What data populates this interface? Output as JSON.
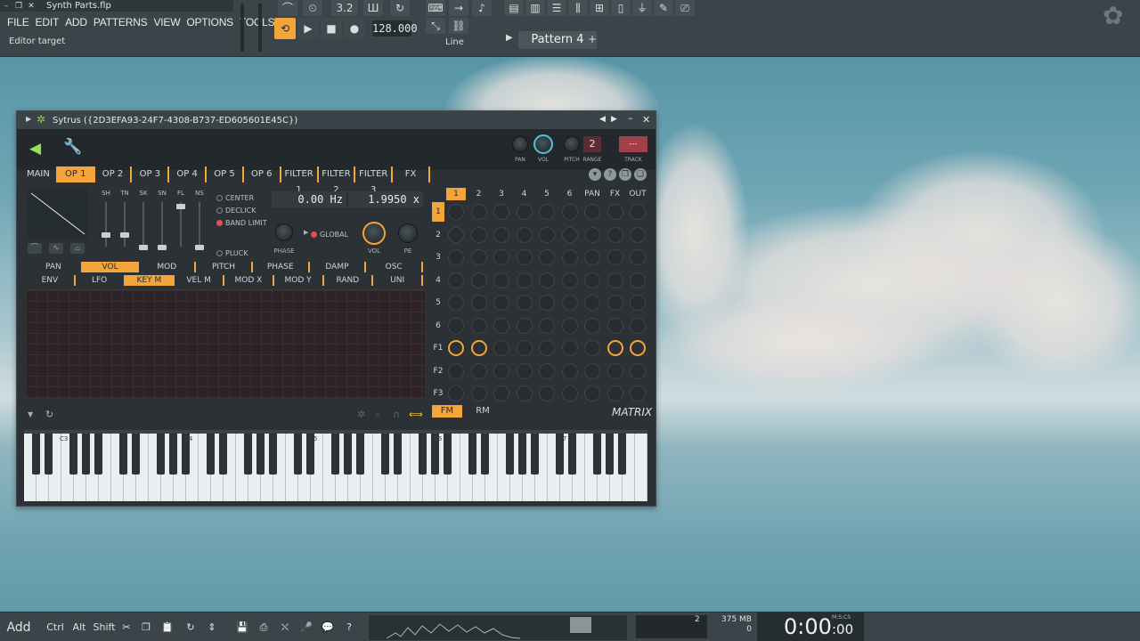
{
  "app": {
    "file_name": "Synth Parts.flp",
    "menu": [
      "FILE",
      "EDIT",
      "ADD",
      "PATTERNS",
      "VIEW",
      "OPTIONS",
      "TOOLS",
      "?"
    ],
    "hint": "Editor target",
    "tempo": "128.000",
    "pattern": "Pattern 4",
    "snap": "Line",
    "cpu_bars": "3.2"
  },
  "plugin": {
    "title": "Sytrus ({2D3EFA93-24F7-4308-B737-ED605601E45C})",
    "head_labels": {
      "pan": "PAN",
      "vol": "VOL",
      "pitch": "PITCH",
      "range": "RANGE",
      "range_value": "2",
      "track": "TRACK",
      "track_value": "---"
    },
    "tabs": [
      {
        "label": "MAIN",
        "sel": false
      },
      {
        "label": "OP 1",
        "sel": true
      },
      {
        "label": "OP 2",
        "sel": false
      },
      {
        "label": "OP 3",
        "sel": false
      },
      {
        "label": "OP 4",
        "sel": false
      },
      {
        "label": "OP 5",
        "sel": false
      },
      {
        "label": "OP 6",
        "sel": false
      },
      {
        "label": "FILTER 1",
        "sel": false
      },
      {
        "label": "FILTER 2",
        "sel": false
      },
      {
        "label": "FILTER 3",
        "sel": false
      },
      {
        "label": "FX",
        "sel": false
      }
    ],
    "slider_labels": [
      "SH",
      "TN",
      "SK",
      "SN",
      "FL",
      "NS"
    ],
    "options": {
      "center": "CENTER",
      "declick": "DECLICK",
      "band_limit": "BAND LIMIT",
      "pluck": "PLUCK",
      "global": "GLOBAL"
    },
    "freq": "0.00 Hz",
    "ratio": "1.9950 x",
    "knob_labels": {
      "phase": "PHASE",
      "vol": "VOL",
      "pe": "PE"
    },
    "sub_tabs_1": [
      {
        "label": "PAN",
        "sel": false
      },
      {
        "label": "VOL",
        "sel": true
      },
      {
        "label": "MOD",
        "sel": false
      },
      {
        "label": "PITCH",
        "sel": false
      },
      {
        "label": "PHASE",
        "sel": false
      },
      {
        "label": "DAMP",
        "sel": false
      },
      {
        "label": "OSC",
        "sel": false
      }
    ],
    "sub_tabs_2": [
      {
        "label": "ENV",
        "sel": false
      },
      {
        "label": "LFO",
        "sel": false
      },
      {
        "label": "KEY M",
        "sel": true
      },
      {
        "label": "VEL M",
        "sel": false
      },
      {
        "label": "MOD X",
        "sel": false
      },
      {
        "label": "MOD Y",
        "sel": false
      },
      {
        "label": "RAND",
        "sel": false
      },
      {
        "label": "UNI",
        "sel": false
      }
    ],
    "matrix": {
      "cols": [
        "1",
        "2",
        "3",
        "4",
        "5",
        "6",
        "PAN",
        "FX",
        "OUT"
      ],
      "rows": [
        "1",
        "2",
        "3",
        "4",
        "5",
        "6",
        "F1",
        "F2",
        "F3"
      ],
      "fm": "FM",
      "rm": "RM",
      "label": "MATRIX"
    },
    "octaves": [
      "C3",
      "C4",
      "C5",
      "C6",
      "C7"
    ]
  },
  "bottom": {
    "add": "Add",
    "ctrl": "Ctrl",
    "alt": "Alt",
    "shift": "Shift",
    "mem": "375 MB",
    "cpu": "2",
    "voices": "0",
    "time": "0:00",
    "time_small": ":00",
    "mscs": "M:S:CS"
  }
}
